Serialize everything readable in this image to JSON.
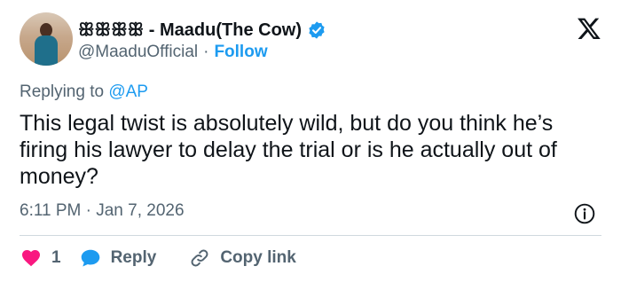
{
  "author": {
    "display_name": "ꕥꕥꕥꕥ - Maadu(The Cow)",
    "handle": "@MaaduOfficial",
    "separator": "·",
    "follow_label": "Follow",
    "verified": true
  },
  "reply_context": {
    "prefix": "Replying to",
    "mention": "@AP"
  },
  "tweet": {
    "text": "This legal twist is absolutely wild, but do you think he’s firing his lawyer to delay the trial or is he actually out of money?",
    "timestamp": "6:11 PM · Jan 7, 2026"
  },
  "actions": {
    "like_count": "1",
    "reply_label": "Reply",
    "copy_link_label": "Copy link"
  },
  "icons": {
    "verified": "verified-badge-icon",
    "platform": "x-logo-icon",
    "info": "info-icon",
    "like": "heart-icon",
    "reply": "speech-bubble-icon",
    "copy": "link-icon"
  },
  "colors": {
    "accent": "#1d9bf0",
    "like": "#f91880",
    "text": "#0f1419",
    "muted": "#536471"
  }
}
